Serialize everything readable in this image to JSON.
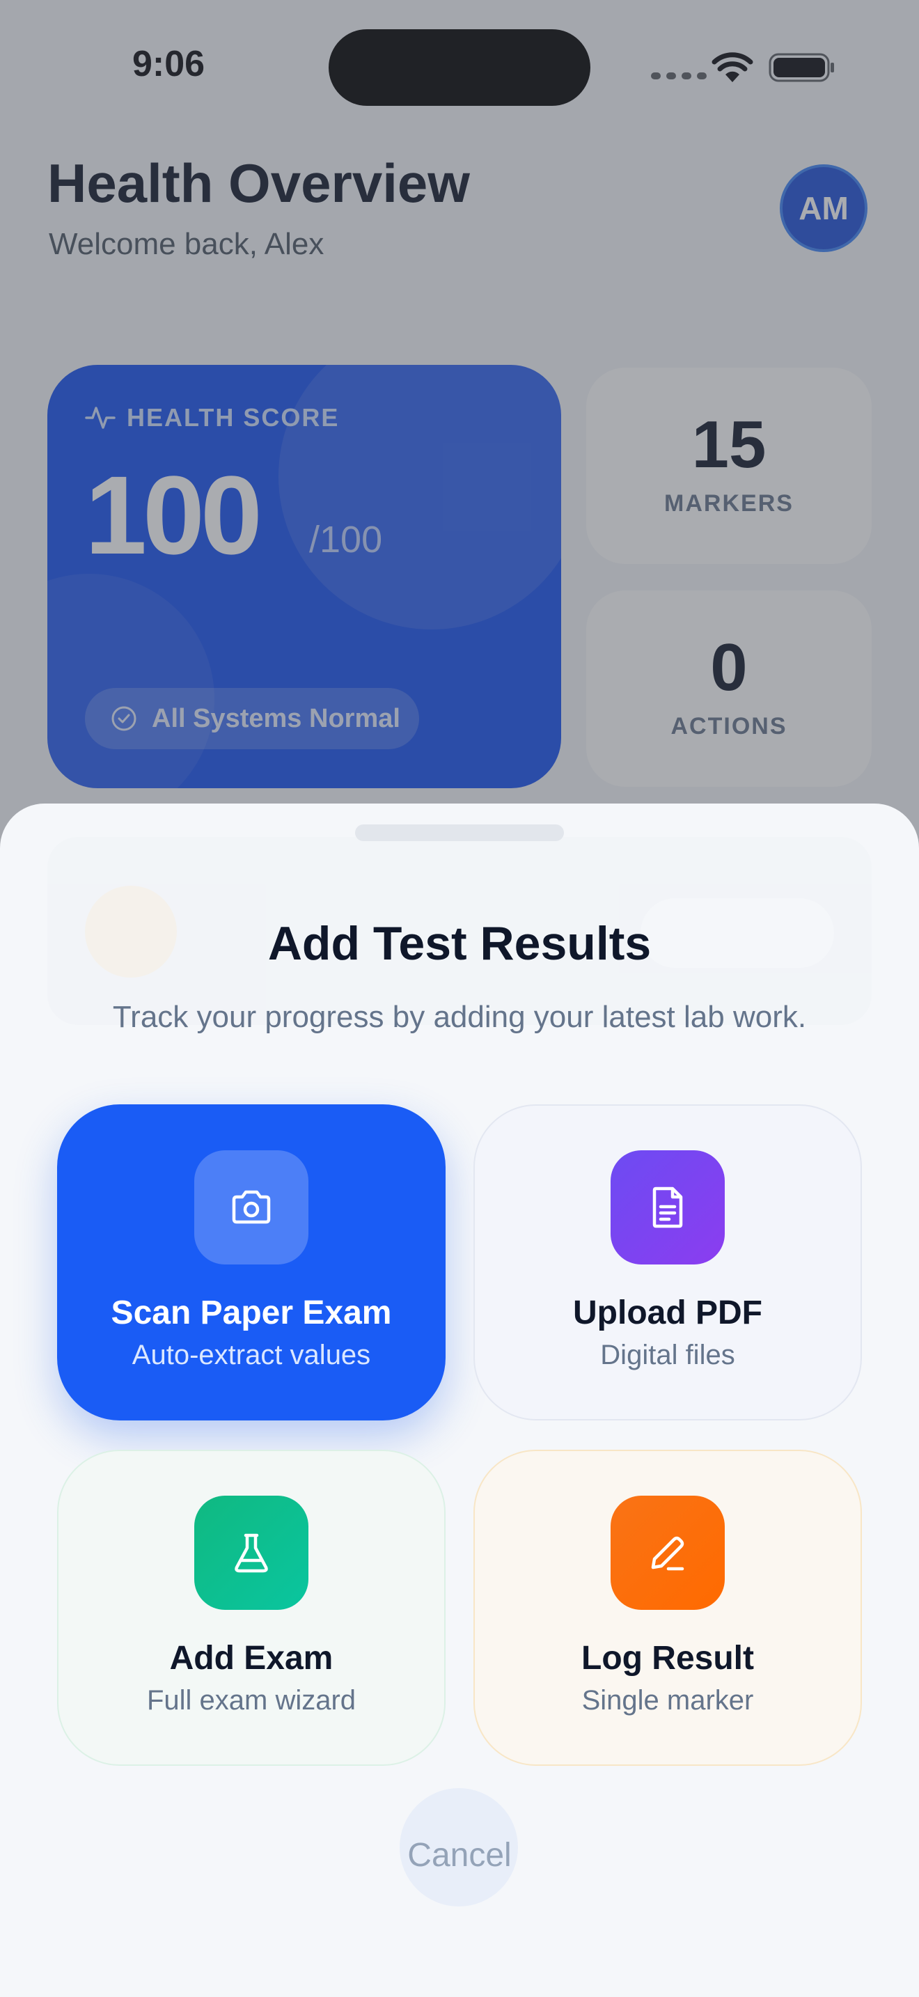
{
  "status_bar": {
    "time": "9:06"
  },
  "header": {
    "title": "Health Overview",
    "subtitle": "Welcome back, Alex",
    "avatar_initials": "AM"
  },
  "health_score": {
    "label": "HEALTH SCORE",
    "value": "100",
    "max": "/100",
    "status": "All Systems Normal"
  },
  "stats": [
    {
      "value": "15",
      "label": "MARKERS"
    },
    {
      "value": "0",
      "label": "ACTIONS"
    }
  ],
  "sheet": {
    "title": "Add Test Results",
    "subtitle": "Track your progress by adding your latest lab work.",
    "options": [
      {
        "title": "Scan Paper Exam",
        "subtitle": "Auto-extract values",
        "icon": "camera-icon"
      },
      {
        "title": "Upload PDF",
        "subtitle": "Digital files",
        "icon": "document-icon"
      },
      {
        "title": "Add Exam",
        "subtitle": "Full exam wizard",
        "icon": "flask-icon"
      },
      {
        "title": "Log Result",
        "subtitle": "Single marker",
        "icon": "pencil-icon"
      }
    ],
    "cancel_label": "Cancel"
  },
  "colors": {
    "primary": "#1a5cf5",
    "upload_accent": "#7c3aed",
    "add_accent": "#10b981",
    "log_accent": "#f97316"
  }
}
